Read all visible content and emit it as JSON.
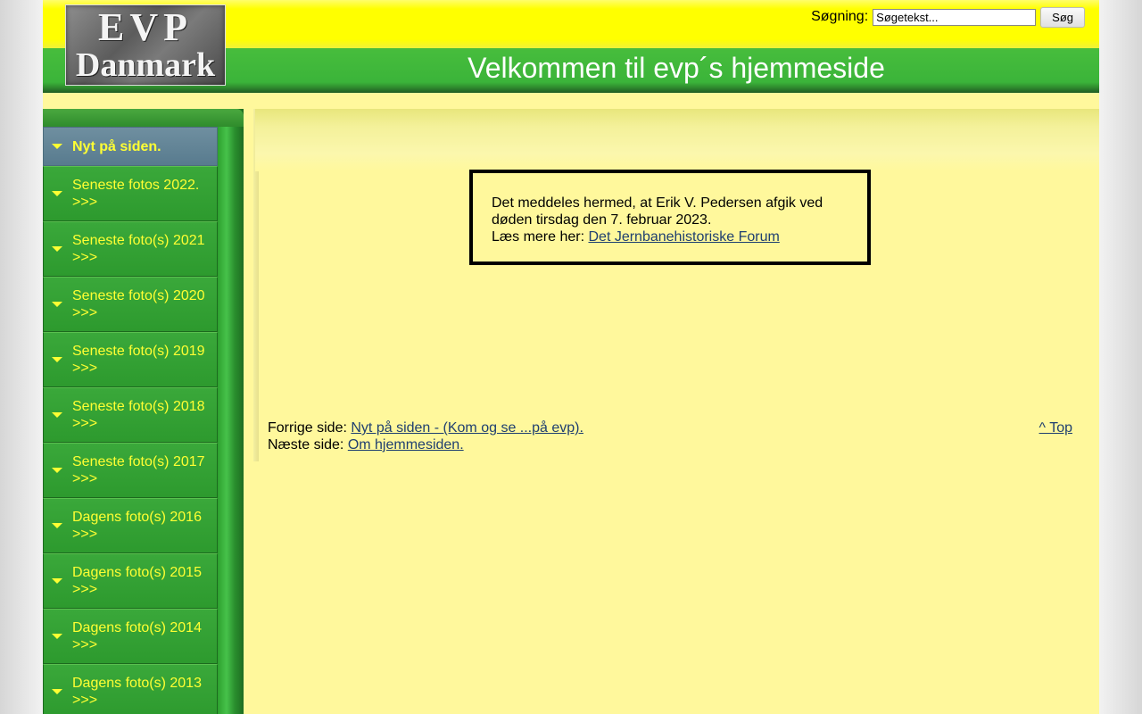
{
  "header": {
    "logo_line1": "EVP",
    "logo_line2": "Danmark",
    "welcome": "Velkommen til evp´s hjemmeside"
  },
  "search": {
    "label": "Søgning:",
    "value": "Søgetekst...",
    "button": "Søg"
  },
  "sidebar": {
    "items": [
      {
        "label": "Nyt på siden."
      },
      {
        "label": "Seneste fotos 2022. >>>"
      },
      {
        "label": "Seneste foto(s) 2021 >>>"
      },
      {
        "label": "Seneste foto(s) 2020 >>>"
      },
      {
        "label": "Seneste foto(s) 2019 >>>"
      },
      {
        "label": "Seneste foto(s) 2018 >>>"
      },
      {
        "label": "Seneste foto(s) 2017 >>>"
      },
      {
        "label": "Dagens foto(s) 2016 >>>"
      },
      {
        "label": "Dagens foto(s) 2015 >>>"
      },
      {
        "label": "Dagens foto(s) 2014 >>>"
      },
      {
        "label": "Dagens foto(s) 2013 >>>"
      }
    ]
  },
  "notice": {
    "line1": "Det meddeles hermed, at Erik V. Pedersen afgik ved døden tirsdag den 7. februar 2023.",
    "read_more_prefix": "Læs mere her: ",
    "read_more_link": "Det Jernbanehistoriske Forum"
  },
  "footer_nav": {
    "prev_label": "Forrige side: ",
    "prev_link": "Nyt på siden - (Kom og se ...på evp).",
    "next_label": "Næste side: ",
    "next_link": "Om hjemmesiden.",
    "top_link": "^ Top"
  },
  "colors": {
    "header_yellow": "#ffff00",
    "header_green": "#3bb43a",
    "sidebar_green": "#2ea12f",
    "nav_text": "#ffff33",
    "content_bg": "#fff89c",
    "link": "#1f3f70"
  }
}
